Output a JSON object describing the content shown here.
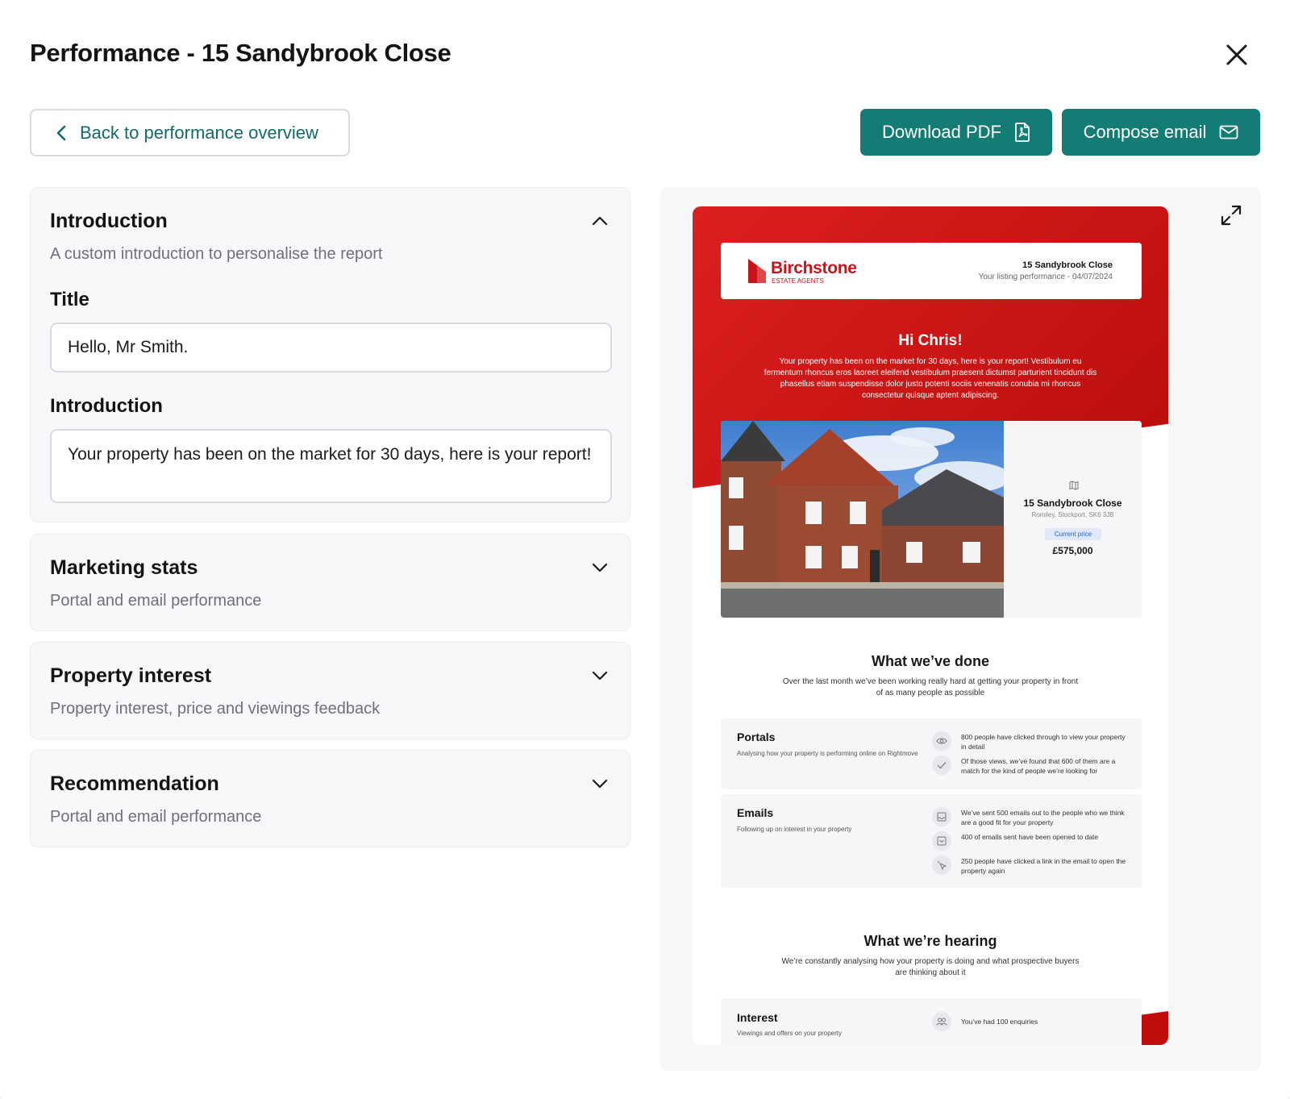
{
  "modal": {
    "title": "Performance - 15 Sandybrook Close"
  },
  "actions": {
    "back_label": "Back to performance overview",
    "download_label": "Download PDF",
    "compose_label": "Compose email"
  },
  "sections": {
    "introduction": {
      "title": "Introduction",
      "subtitle": "A custom introduction to personalise the report",
      "title_field_label": "Title",
      "title_field_value": "Hello, Mr Smith.",
      "intro_field_label": "Introduction",
      "intro_field_value": "Your property has been on the market for 30 days, here is your report!"
    },
    "marketing": {
      "title": "Marketing stats",
      "subtitle": "Portal and email performance"
    },
    "interest": {
      "title": "Property interest",
      "subtitle": "Property interest, price and viewings feedback"
    },
    "recommendation": {
      "title": "Recommendation",
      "subtitle": "Portal and email performance"
    }
  },
  "preview": {
    "brand_name": "Birchstone",
    "brand_sub": "ESTATE AGENTS",
    "address": "15 Sandybrook Close",
    "listing_line": "Your listing performance - 04/07/2024",
    "greeting": "Hi Chris!",
    "greeting_text": "Your property has been on the market for 30 days, here is your report! Vestibulum eu fermentum rhoncus eros laoreet eleifend vestibulum praesent dictumst parturient tincidunt dis phasellus etiam suspendisse dolor justo potenti sociis venenatis conubia mi rhoncus consectetur quisque aptent adipiscing.",
    "property_name": "15 Sandybrook Close",
    "property_location": "Romiley, Stockport, SK6 3JB",
    "price_badge": "Current price",
    "price": "£575,000",
    "done_title": "What we’ve done",
    "done_sub": "Over the last month we’ve been working really hard at getting your property in front of as many people as possible",
    "portals_title": "Portals",
    "portals_sub": "Analysing how your property is performing online on Rightmove",
    "portals_stats": [
      "800 people have clicked through to view your property in detail",
      "Of those views, we’ve found that 600 of them are a match for the kind of people we’re looking for"
    ],
    "emails_title": "Emails",
    "emails_sub": "Following up on interest in your property",
    "emails_stats": [
      "We’ve sent 500 emails out to the people who we think are a good fit for your property",
      "400 of emails sent have been opened to date",
      "250 people have clicked a link in the email to open the property again"
    ],
    "hearing_title": "What we’re hearing",
    "hearing_sub": "We’re constantly analysing how your property is doing and what prospective buyers are thinking about it",
    "interest_title": "Interest",
    "interest_sub": "Viewings and offers on your property",
    "interest_stat": "You’ve had 100 enquiries"
  },
  "colors": {
    "primary": "#137c74",
    "brand_red": "#c8151b",
    "badge_blue": "#2760c4"
  },
  "icons": [
    "close-icon",
    "chevron-left-icon",
    "pdf-icon",
    "mail-icon",
    "chevron-up-icon",
    "chevron-down-icon",
    "expand-icon",
    "map-icon",
    "eye-icon",
    "check-icon",
    "inbox-icon",
    "mail-open-icon",
    "cursor-click-icon",
    "people-icon"
  ]
}
